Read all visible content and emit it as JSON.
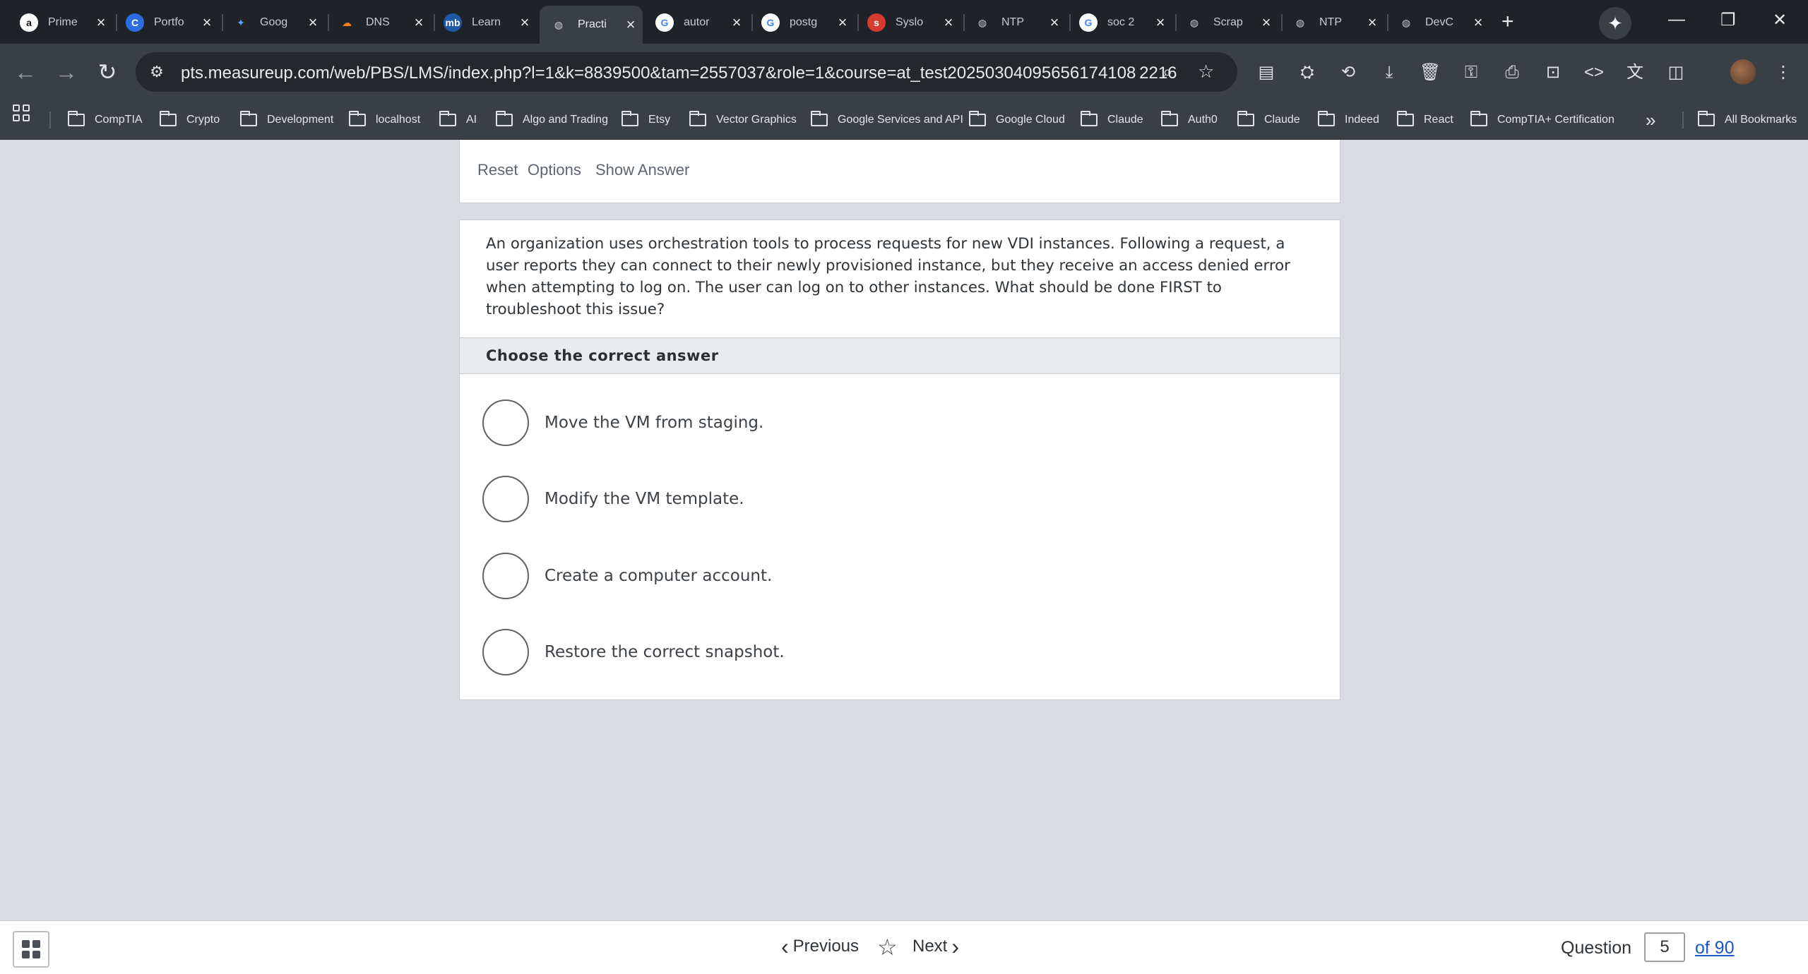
{
  "browser": {
    "tabs": [
      {
        "title": "Prime",
        "favicon": "amazon-icon"
      },
      {
        "title": "Portfo",
        "favicon": "portfolio-icon"
      },
      {
        "title": "Goog",
        "favicon": "gemini-icon"
      },
      {
        "title": "DNS",
        "favicon": "cloudflare-icon"
      },
      {
        "title": "Learn",
        "favicon": "measureup-icon"
      },
      {
        "title": "Practi",
        "favicon": "globe-icon",
        "active": true
      },
      {
        "title": "autor",
        "favicon": "google-icon"
      },
      {
        "title": "postg",
        "favicon": "google-icon"
      },
      {
        "title": "Syslo",
        "favicon": "syslog-icon"
      },
      {
        "title": "NTP",
        "favicon": "globe-icon"
      },
      {
        "title": "soc 2",
        "favicon": "google-icon"
      },
      {
        "title": "Scrap",
        "favicon": "globe-icon"
      },
      {
        "title": "NTP",
        "favicon": "globe-icon"
      },
      {
        "title": "DevC",
        "favicon": "globe-icon"
      }
    ],
    "url": "pts.measureup.com/web/PBS/LMS/index.php?l=1&k=8839500&tam=2557037&role=1&course=at_test20250304095656174108 2216",
    "url_display": "pts.measureup.com/web/PBS/LMS/index.php?l=1&k=8839500&tam=2557037&role=1&course=at_test20250304095656174108 2216",
    "bookmarks": [
      "CompTIA",
      "Crypto",
      "Development",
      "localhost",
      "AI",
      "Algo and Trading",
      "Etsy",
      "Vector Graphics",
      "Google Services and API",
      "Google Cloud",
      "Claude",
      "Auth0",
      "Claude",
      "Indeed",
      "React",
      "CompTIA+ Certification"
    ],
    "all_bookmarks": "All Bookmarks",
    "overflow": "»"
  },
  "quiz": {
    "toolbar": {
      "reset": "Reset",
      "options": "Options",
      "show_answer": "Show Answer"
    },
    "question": "An organization uses orchestration tools to process requests for new VDI instances. Following a request, a user reports they can connect to their newly provisioned instance, but they receive an access denied error when attempting to log on. The user can log on to other instances. What should be done FIRST to troubleshoot this issue?",
    "instruction": "Choose the correct answer",
    "options": [
      "Move the VM from staging.",
      "Modify the VM template.",
      "Create a computer account.",
      "Restore the correct snapshot."
    ]
  },
  "footer": {
    "previous": "Previous",
    "next": "Next",
    "question_label": "Question",
    "question_number": "5",
    "of_total": "of 90"
  },
  "colors": {
    "accent_link": "#1a56c8",
    "page_bg": "#d8dce1",
    "chrome_bg": "#3a3f45"
  }
}
